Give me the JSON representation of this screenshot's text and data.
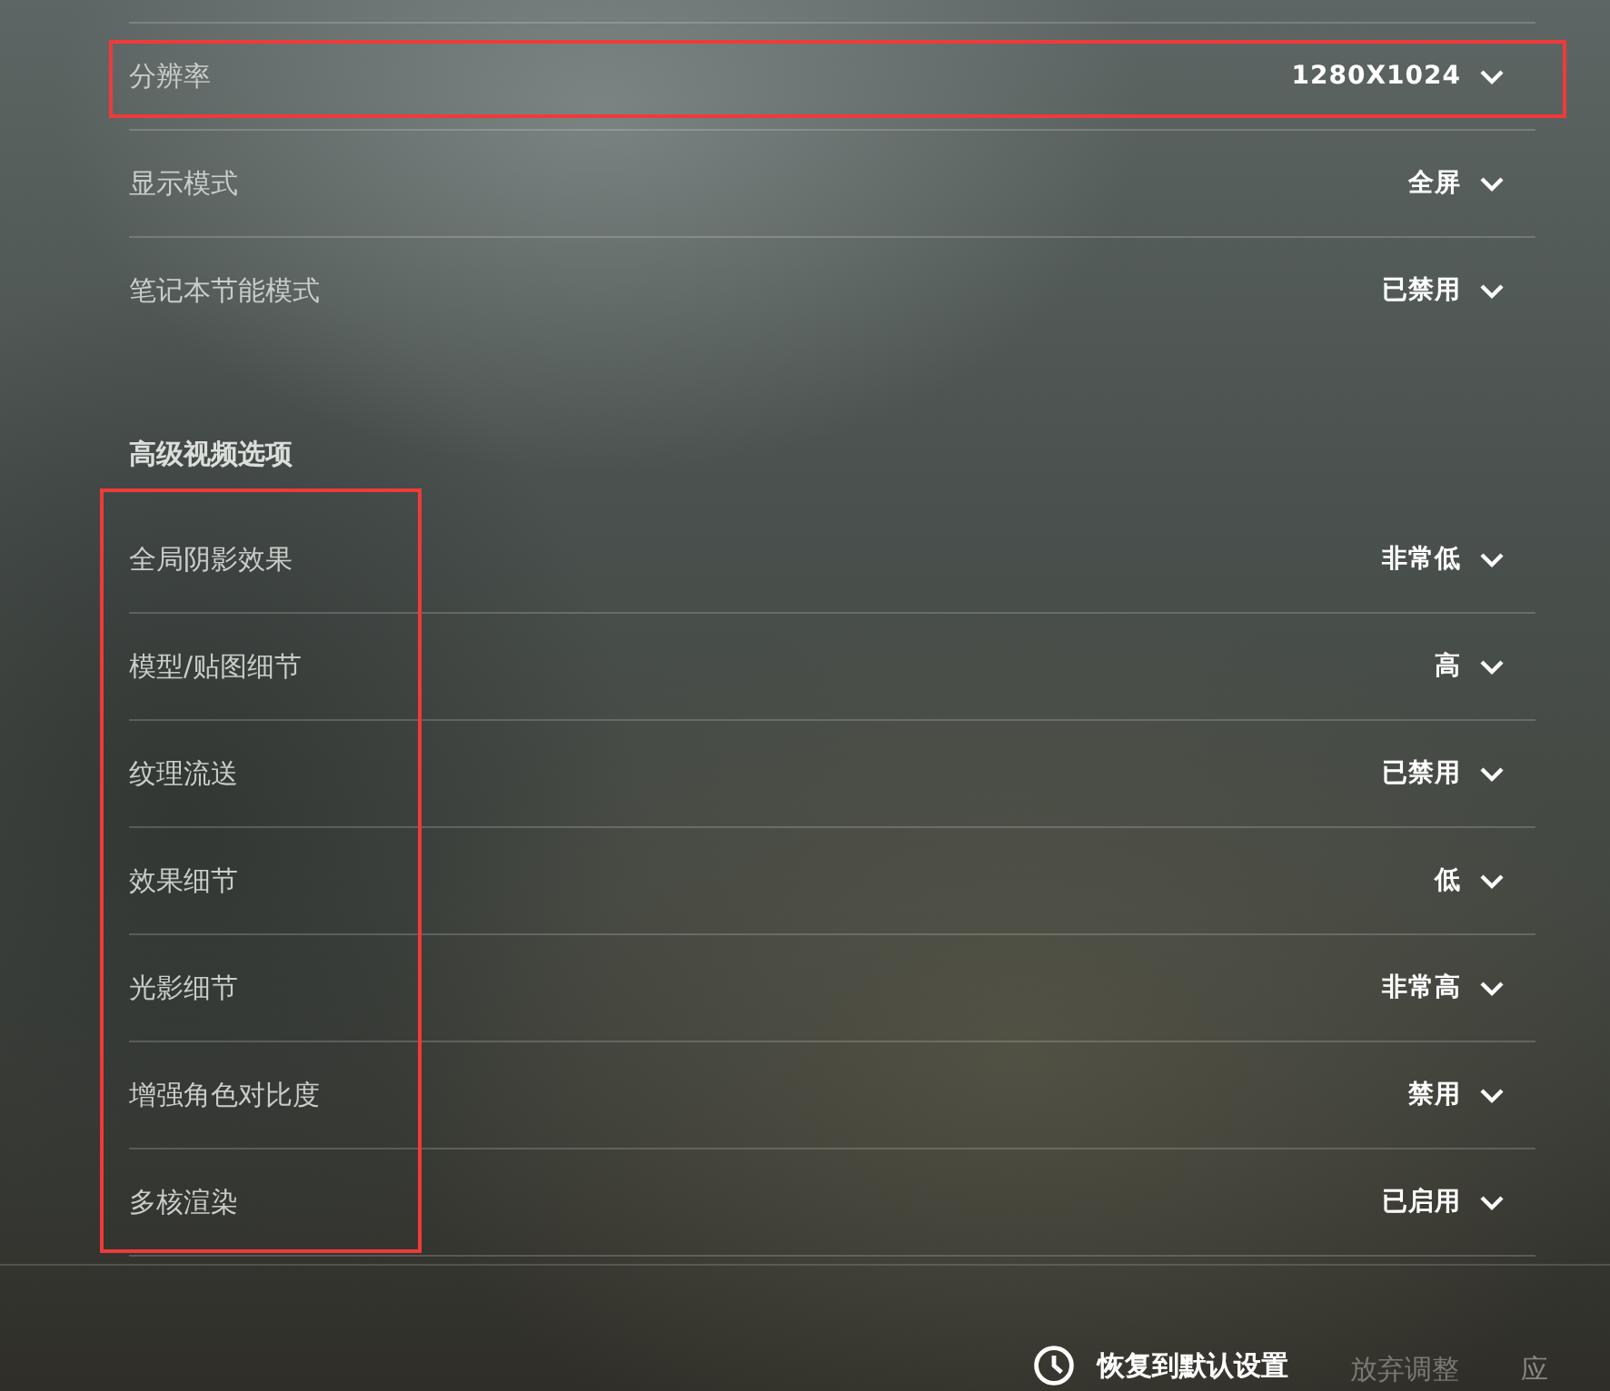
{
  "basic_settings": [
    {
      "label": "分辨率",
      "value": "1280X1024",
      "highlighted": true
    },
    {
      "label": "显示模式",
      "value": "全屏",
      "highlighted": false
    },
    {
      "label": "笔记本节能模式",
      "value": "已禁用",
      "highlighted": false
    }
  ],
  "advanced_section": {
    "title": "高级视频选项",
    "labels_highlighted": true,
    "settings": [
      {
        "label": "全局阴影效果",
        "value": "非常低"
      },
      {
        "label": "模型/贴图细节",
        "value": "高"
      },
      {
        "label": "纹理流送",
        "value": "已禁用"
      },
      {
        "label": "效果细节",
        "value": "低"
      },
      {
        "label": "光影细节",
        "value": "非常高"
      },
      {
        "label": "增强角色对比度",
        "value": "禁用"
      },
      {
        "label": "多核渲染",
        "value": "已启用"
      }
    ]
  },
  "footer_buttons": [
    {
      "label": "恢复到默认设置",
      "kind": "restore"
    },
    {
      "label": "放弃调整",
      "kind": "discard"
    },
    {
      "label": "应",
      "kind": "apply"
    }
  ]
}
